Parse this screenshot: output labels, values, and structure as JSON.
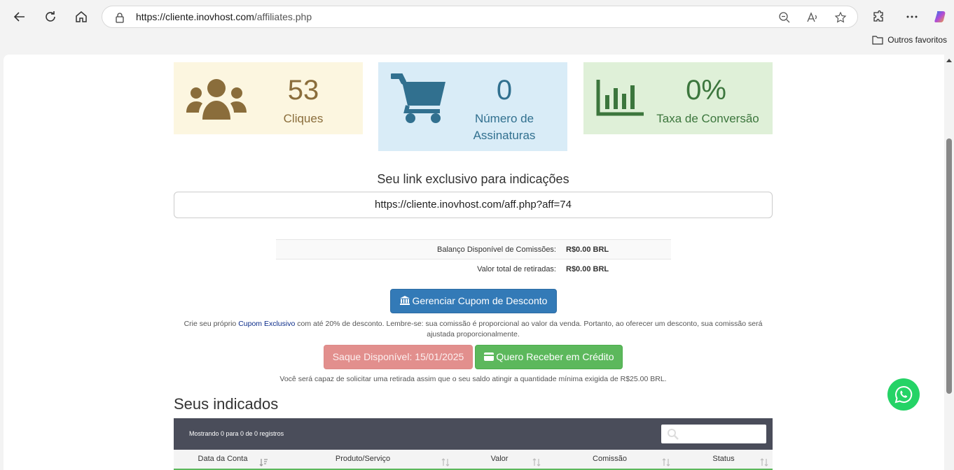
{
  "browser": {
    "url_host": "https://cliente.inovhost.com",
    "url_path": "/affiliates.php",
    "favorites_label": "Outros favoritos"
  },
  "stats": {
    "clicks": {
      "value": "53",
      "label": "Cliques"
    },
    "signups": {
      "value": "0",
      "label_line1": "Número de",
      "label_line2": "Assinaturas"
    },
    "conversion": {
      "value": "0%",
      "label": "Taxa de Conversão"
    }
  },
  "referral": {
    "title": "Seu link exclusivo para indicações",
    "link": "https://cliente.inovhost.com/aff.php?aff=74"
  },
  "balance": {
    "rows": [
      {
        "label": "Balanço Disponível de Comissões:",
        "value": "R$0.00 BRL"
      },
      {
        "label": "Valor total de retiradas:",
        "value": "R$0.00 BRL"
      }
    ]
  },
  "coupon": {
    "button_label": "Gerenciar Cupom de Desconto",
    "note_prefix": "Crie seu próprio",
    "note_link": "Cupom Exclusivo",
    "note_suffix": "com até 20% de desconto. Lembre-se: sua comissão é proporcional ao valor da venda. Portanto, ao oferecer um desconto, sua comissão será ajustada proporcionalmente."
  },
  "withdraw": {
    "available_label": "Saque Disponível: 15/01/2025",
    "credit_label": "Quero Receber em Crédito",
    "note": "Você será capaz de solicitar uma retirada assim que o seu saldo atingir a quantidade mínima exigida de R$25.00 BRL."
  },
  "referrals": {
    "title": "Seus indicados",
    "info": "Mostrando 0 para 0 de 0 registros",
    "search_placeholder": "",
    "columns": [
      "Data da Conta",
      "Produto/Serviço",
      "Valor",
      "Comissão",
      "Status"
    ]
  },
  "colors": {
    "accent_blue": "#337ab7",
    "success_green": "#5cb85c",
    "danger_soft": "#e28f8d",
    "whatsapp": "#25d366"
  }
}
